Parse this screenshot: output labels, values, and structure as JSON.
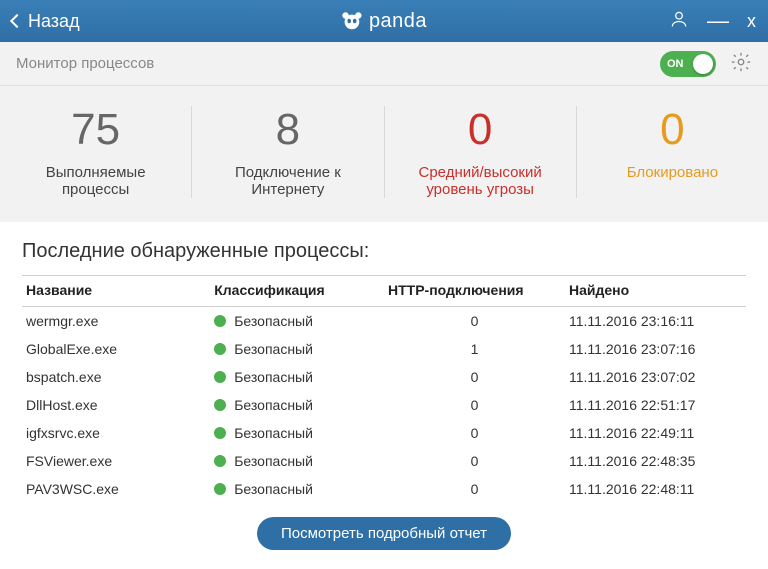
{
  "titlebar": {
    "back_label": "Назад",
    "brand": "panda"
  },
  "subbar": {
    "title": "Монитор процессов",
    "toggle": "ON"
  },
  "stats": [
    {
      "value": "75",
      "label": "Выполняемые процессы",
      "cls": ""
    },
    {
      "value": "8",
      "label": "Подключение к Интернету",
      "cls": ""
    },
    {
      "value": "0",
      "label": "Средний/высокий уровень угрозы",
      "cls": "red"
    },
    {
      "value": "0",
      "label": "Блокировано",
      "cls": "orange"
    }
  ],
  "section_title": "Последние обнаруженные процессы:",
  "columns": {
    "name": "Название",
    "classification": "Классификация",
    "http": "HTTP-подключения",
    "found": "Найдено"
  },
  "rows": [
    {
      "name": "wermgr.exe",
      "classification": "Безопасный",
      "http": "0",
      "found": "11.11.2016 23:16:11"
    },
    {
      "name": "GlobalExe.exe",
      "classification": "Безопасный",
      "http": "1",
      "found": "11.11.2016 23:07:16"
    },
    {
      "name": "bspatch.exe",
      "classification": "Безопасный",
      "http": "0",
      "found": "11.11.2016 23:07:02"
    },
    {
      "name": "DllHost.exe",
      "classification": "Безопасный",
      "http": "0",
      "found": "11.11.2016 22:51:17"
    },
    {
      "name": "igfxsrvc.exe",
      "classification": "Безопасный",
      "http": "0",
      "found": "11.11.2016 22:49:11"
    },
    {
      "name": "FSViewer.exe",
      "classification": "Безопасный",
      "http": "0",
      "found": "11.11.2016 22:48:35"
    },
    {
      "name": "PAV3WSC.exe",
      "classification": "Безопасный",
      "http": "0",
      "found": "11.11.2016 22:48:11"
    }
  ],
  "report_button": "Посмотреть подробный отчет"
}
